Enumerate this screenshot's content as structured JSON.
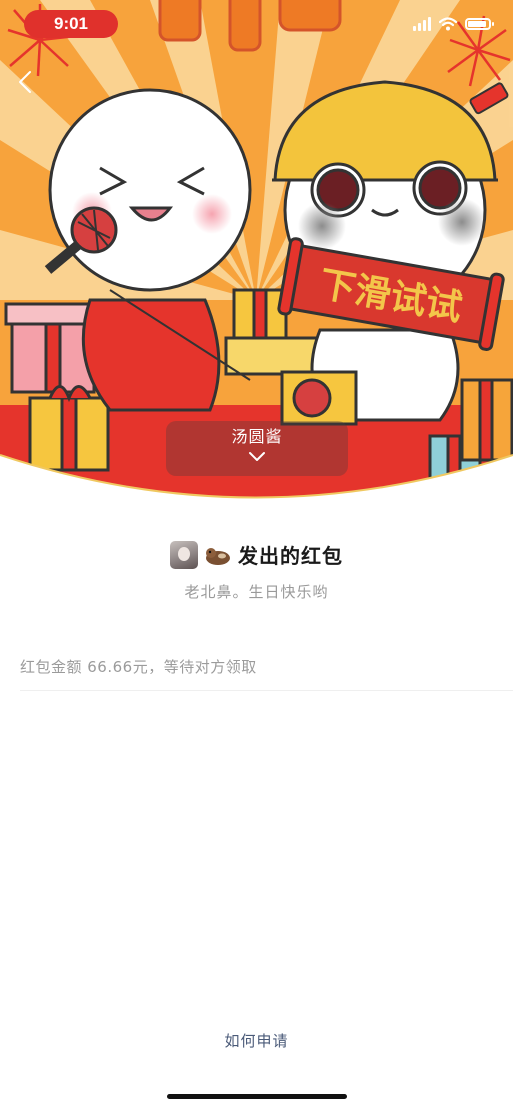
{
  "status_bar": {
    "time": "9:01"
  },
  "cover": {
    "banner_text": "下滑试试",
    "sender_name": "汤圆酱",
    "colors": {
      "background": "#f7a33c",
      "ray": "#fbd89a",
      "red_carpet": "#e5342c",
      "banner_red": "#d9382e",
      "banner_text": "#f3c64a"
    }
  },
  "envelope": {
    "title": "发出的红包",
    "greeting": "老北鼻。生日快乐哟",
    "amount_status": "红包金额 66.66元，等待对方领取"
  },
  "footer": {
    "help_link": "如何申请"
  },
  "icons": [
    "back-chevron-icon",
    "signal-icon",
    "wifi-icon",
    "battery-icon",
    "chevron-down-icon",
    "otter-emoji-icon"
  ]
}
